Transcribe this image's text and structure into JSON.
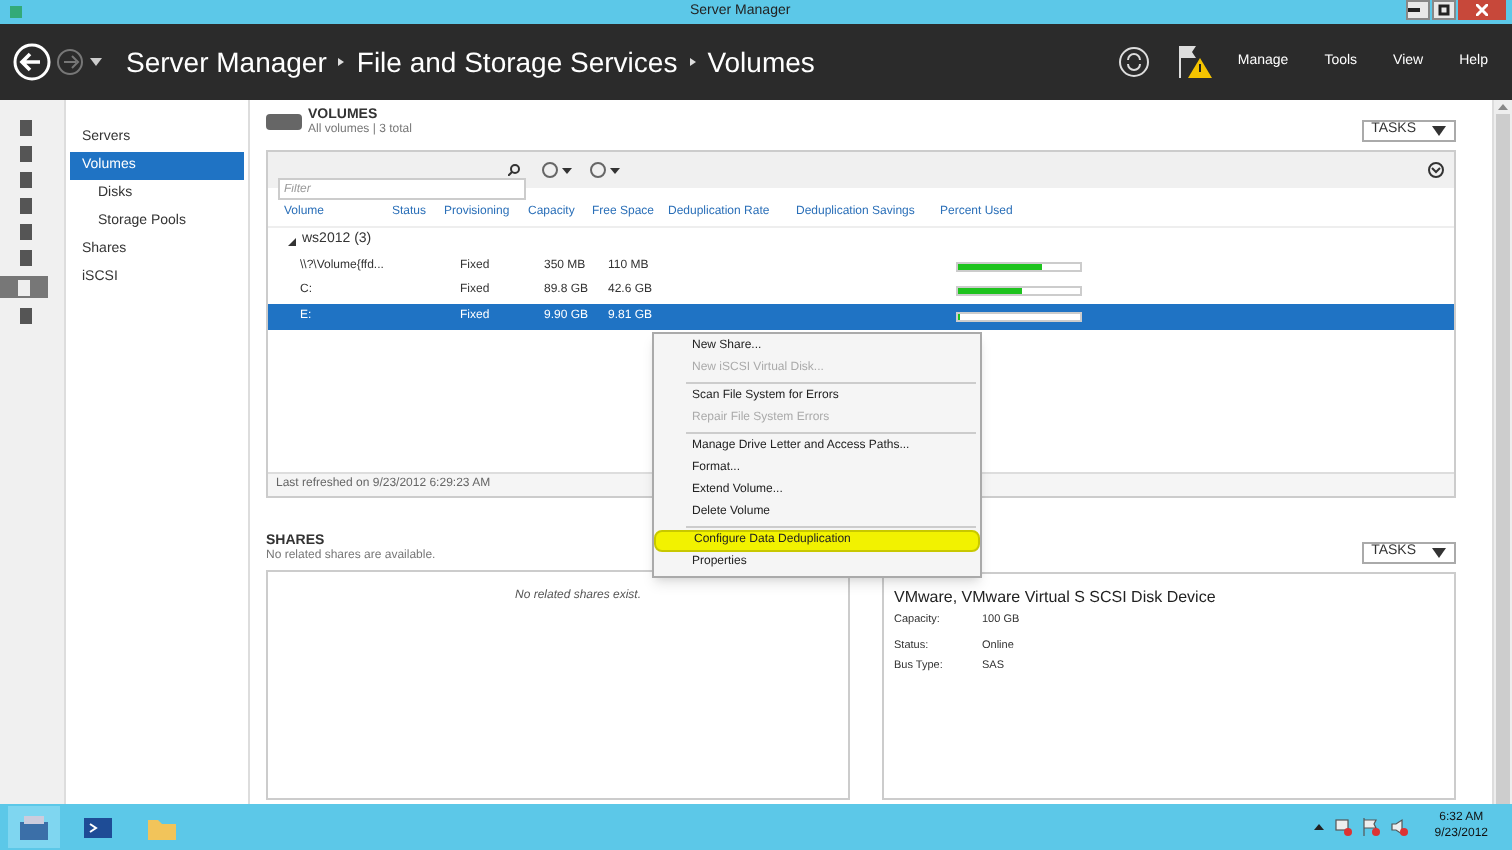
{
  "window": {
    "title": "Server Manager"
  },
  "breadcrumb": [
    "Server Manager",
    "File and Storage Services",
    "Volumes"
  ],
  "menu": [
    "Manage",
    "Tools",
    "View",
    "Help"
  ],
  "nav": [
    {
      "label": "Servers",
      "selected": false
    },
    {
      "label": "Volumes",
      "selected": true,
      "children": [
        {
          "label": "Disks",
          "selected": false
        },
        {
          "label": "Storage Pools",
          "selected": false
        }
      ]
    },
    {
      "label": "Shares",
      "selected": false
    },
    {
      "label": "iSCSI",
      "selected": false
    }
  ],
  "volumes": {
    "title": "VOLUMES",
    "subtitle": "All volumes | 3 total",
    "tasks": "TASKS",
    "filter": {
      "placeholder": "Filter"
    },
    "columns": [
      "Volume",
      "Status",
      "Provisioning",
      "Capacity",
      "Free Space",
      "Deduplication Rate",
      "Deduplication Savings",
      "Percent Used"
    ],
    "group": {
      "label": "ws2012 (3)",
      "expanded": true
    },
    "rows": [
      {
        "volume": "\\\\?\\Volume{ffd...",
        "provisioning": "Fixed",
        "capacity": "350 MB",
        "free": "110 MB",
        "level": 0.69,
        "selected": false
      },
      {
        "volume": "C:",
        "provisioning": "Fixed",
        "capacity": "89.8 GB",
        "free": "42.6 GB",
        "level": 0.53,
        "selected": false
      },
      {
        "volume": "E:",
        "provisioning": "Fixed",
        "capacity": "9.90 GB",
        "free": "9.81 GB",
        "level": 0.01,
        "selected": true
      }
    ],
    "refreshed": "Last refreshed on 9/23/2012 6:29:23 AM"
  },
  "context_menu": [
    {
      "kind": "item",
      "label": "New Share...",
      "disabled": false,
      "selected": false
    },
    {
      "kind": "item",
      "label": "New iSCSI Virtual Disk...",
      "disabled": true,
      "selected": false
    },
    {
      "kind": "separator"
    },
    {
      "kind": "item",
      "label": "Scan File System for Errors",
      "disabled": false,
      "selected": false
    },
    {
      "kind": "item",
      "label": "Repair File System Errors",
      "disabled": true,
      "selected": false
    },
    {
      "kind": "separator"
    },
    {
      "kind": "item",
      "label": "Manage Drive Letter and Access Paths...",
      "disabled": false,
      "selected": false
    },
    {
      "kind": "item",
      "label": "Format...",
      "disabled": false,
      "selected": false
    },
    {
      "kind": "item",
      "label": "Extend Volume...",
      "disabled": false,
      "selected": false
    },
    {
      "kind": "item",
      "label": "Delete Volume",
      "disabled": false,
      "selected": false
    },
    {
      "kind": "separator"
    },
    {
      "kind": "item",
      "label": "Configure Data Deduplication",
      "disabled": false,
      "selected": true
    },
    {
      "kind": "item",
      "label": "Properties",
      "disabled": false,
      "selected": false
    }
  ],
  "shares": {
    "title": "SHARES",
    "subtitle": "No related shares are available.",
    "empty": "No related shares exist."
  },
  "disk": {
    "tasks": "TASKS",
    "name": "VMware, VMware Virtual S SCSI Disk Device",
    "props": [
      {
        "label": "Capacity:",
        "value": "100 GB"
      },
      {
        "label": "Status:",
        "value": "Online"
      },
      {
        "label": "Bus Type:",
        "value": "SAS"
      }
    ]
  },
  "taskbar": {
    "time": "6:32 AM",
    "date": "9/23/2012"
  }
}
